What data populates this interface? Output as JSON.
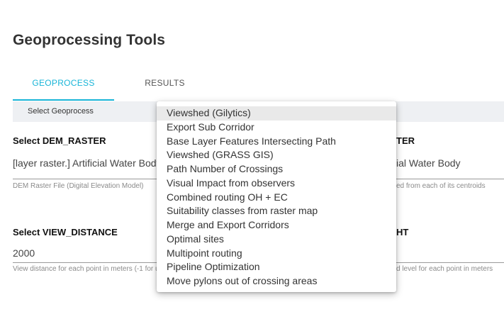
{
  "page": {
    "title": "Geoprocessing Tools"
  },
  "tabs": [
    {
      "label": "GEOPROCESS",
      "active": true
    },
    {
      "label": "RESULTS",
      "active": false
    }
  ],
  "select_bar": {
    "label": "Select Geoprocess"
  },
  "fields": {
    "dem_raster": {
      "label": "Select DEM_RASTER",
      "value": "[layer raster.] Artificial Water Body",
      "help": "DEM Raster File (Digital Elevation Model)"
    },
    "right_top": {
      "label_fragment": "TER",
      "value_fragment": "ial Water Body",
      "help_fragment": "ed from each of its centroids"
    },
    "view_distance": {
      "label": "Select VIEW_DISTANCE",
      "value": "2000",
      "help": "View distance for each point in meters (-1 for unlimited)"
    },
    "right_bottom": {
      "label_fragment": "HT",
      "help_fragment": "d level for each point in meters"
    }
  },
  "dropdown": {
    "selected_index": 0,
    "options": [
      "Viewshed (Gilytics)",
      "Export Sub Corridor",
      "Base Layer Features Intersecting Path",
      "Viewshed (GRASS GIS)",
      "Path Number of Crossings",
      "Visual Impact from observers",
      "Combined routing OH + EC",
      "Suitability classes from raster map",
      "Merge and Export Corridors",
      "Optimal sites",
      "Multipoint routing",
      "Pipeline Optimization",
      "Move pylons out of crossing areas"
    ]
  },
  "colors": {
    "accent": "#19b5d8",
    "select_bar_bg": "#eef0f3",
    "selected_option_bg": "#e9e9e9"
  }
}
